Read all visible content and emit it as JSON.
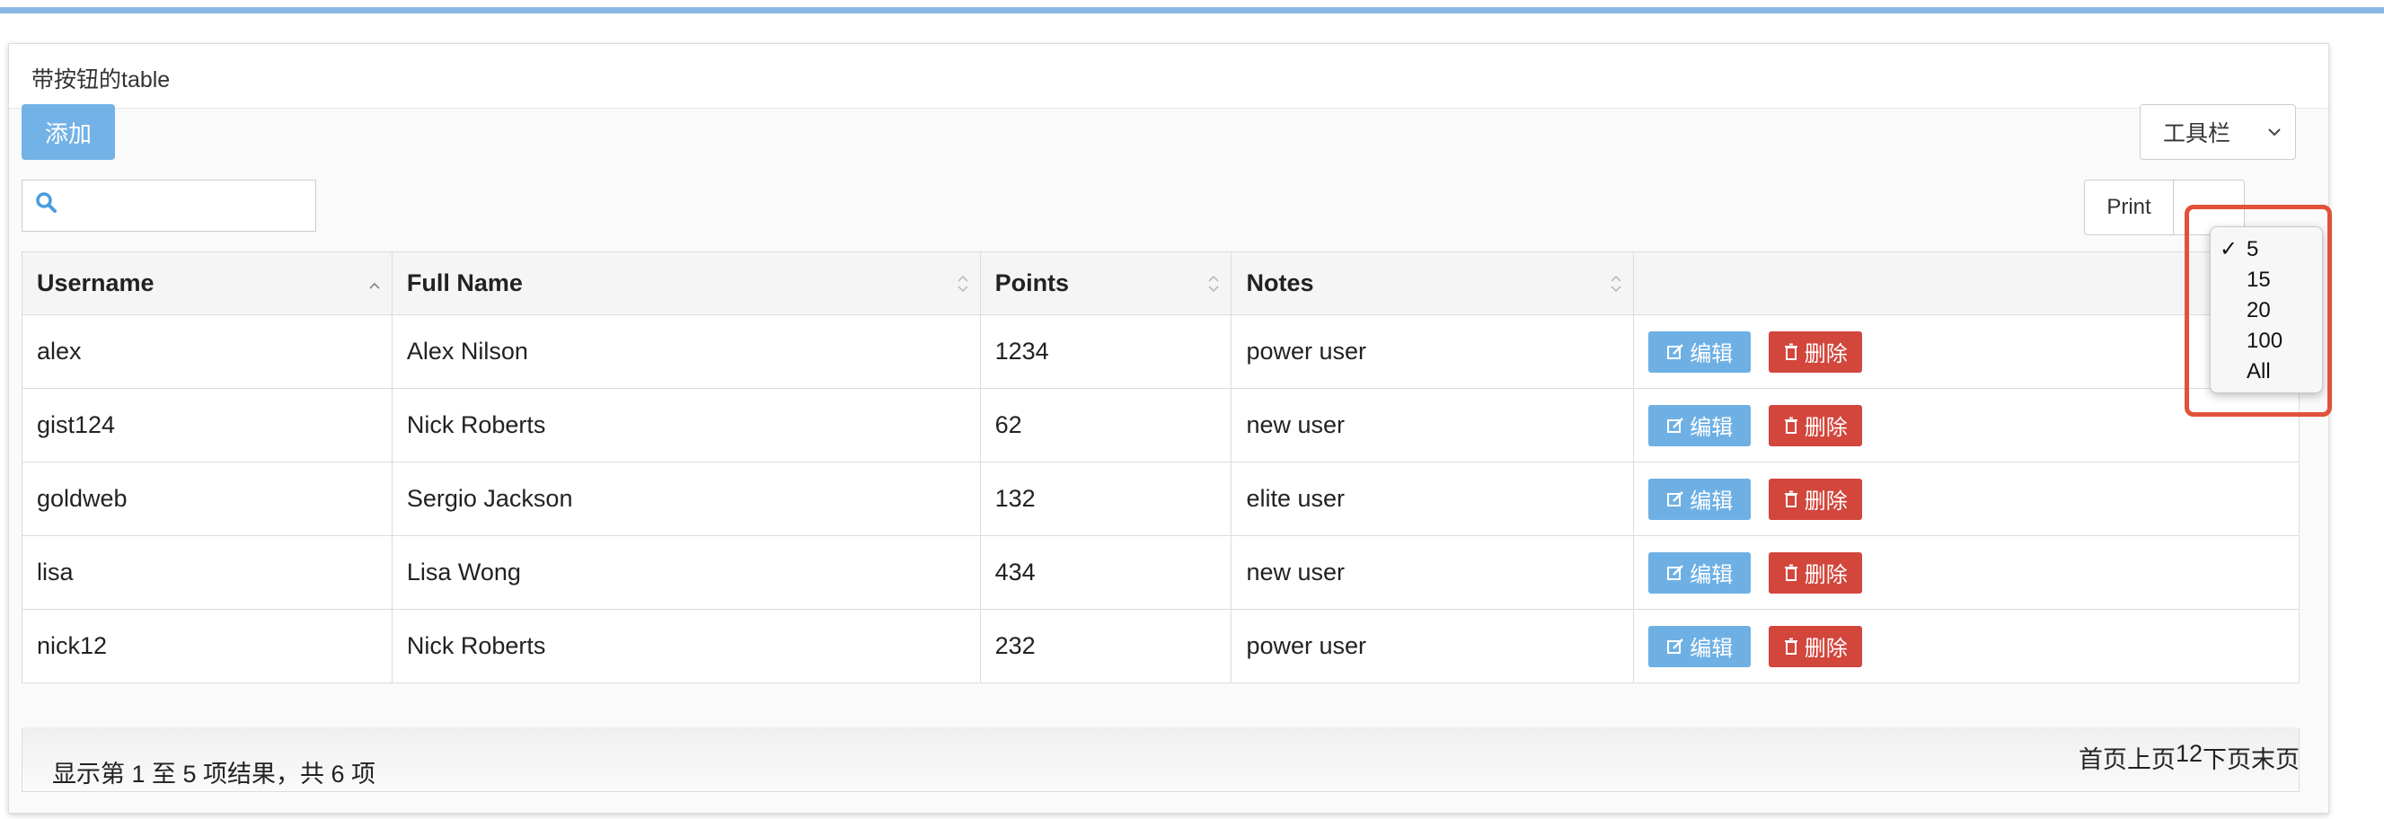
{
  "panel": {
    "title": "带按钮的table"
  },
  "toolbar": {
    "add_label": "添加",
    "toolbar_label": "工具栏",
    "print_label": "Print"
  },
  "search": {
    "placeholder": "",
    "value": ""
  },
  "table": {
    "columns": [
      {
        "label": "Username",
        "sort": "asc"
      },
      {
        "label": "Full Name",
        "sort": "none"
      },
      {
        "label": "Points",
        "sort": "none"
      },
      {
        "label": "Notes",
        "sort": "none"
      },
      {
        "label": "",
        "sort": "none"
      }
    ],
    "rows": [
      {
        "username": "alex",
        "fullname": "Alex Nilson",
        "points": "1234",
        "notes": "power user"
      },
      {
        "username": "gist124",
        "fullname": "Nick Roberts",
        "points": "62",
        "notes": "new user"
      },
      {
        "username": "goldweb",
        "fullname": "Sergio Jackson",
        "points": "132",
        "notes": "elite user"
      },
      {
        "username": "lisa",
        "fullname": "Lisa Wong",
        "points": "434",
        "notes": "new user"
      },
      {
        "username": "nick12",
        "fullname": "Nick Roberts",
        "points": "232",
        "notes": "power user"
      }
    ],
    "actions": {
      "edit_label": "编辑",
      "delete_label": "删除"
    }
  },
  "footer": {
    "info": "显示第 1 至 5 项结果，共 6 项",
    "pager": {
      "first": "首页",
      "prev": "上页",
      "pages": [
        "1",
        "2"
      ],
      "next": "下页",
      "last": "末页"
    }
  },
  "page_size_menu": {
    "options": [
      "5",
      "15",
      "20",
      "100",
      "All"
    ],
    "selected": "5",
    "check_mark": "✓"
  },
  "colors": {
    "accent_blue": "#73b2e6",
    "delete_red": "#d2463c",
    "highlight": "#e2513b",
    "top_bar": "#8ab6e6"
  },
  "icons": {
    "search": "search-icon",
    "caret": "chevron-down-icon",
    "edit": "edit-icon",
    "delete": "trash-icon"
  }
}
